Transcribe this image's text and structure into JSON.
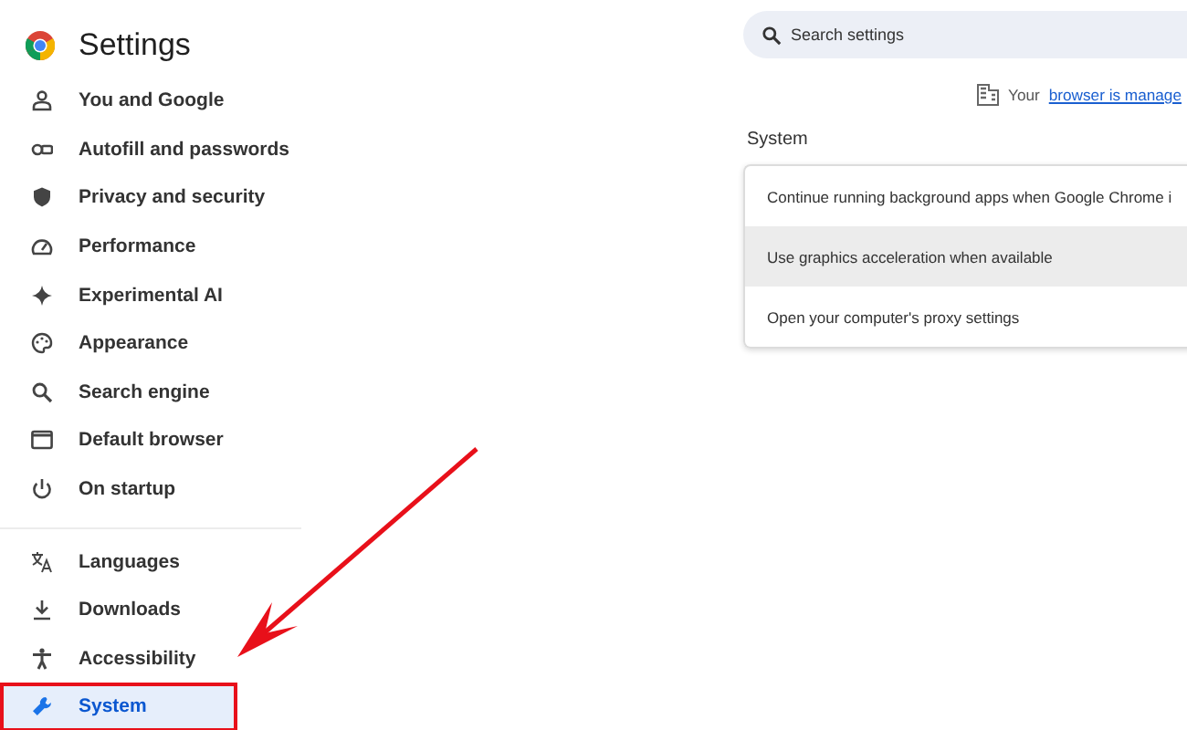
{
  "header": {
    "title": "Settings"
  },
  "sidebar": {
    "groups": [
      [
        {
          "label": "You and Google",
          "selected": false,
          "annotated": false
        },
        {
          "label": "Autofill and passwords",
          "selected": false,
          "annotated": false
        },
        {
          "label": "Privacy and security",
          "selected": false,
          "annotated": false
        },
        {
          "label": "Performance",
          "selected": false,
          "annotated": false
        },
        {
          "label": "Experimental AI",
          "selected": false,
          "annotated": false
        },
        {
          "label": "Appearance",
          "selected": false,
          "annotated": false
        },
        {
          "label": "Search engine",
          "selected": false,
          "annotated": false
        },
        {
          "label": "Default browser",
          "selected": false,
          "annotated": false
        },
        {
          "label": "On startup",
          "selected": false,
          "annotated": false
        }
      ],
      [
        {
          "label": "Languages",
          "selected": false,
          "annotated": false
        },
        {
          "label": "Downloads",
          "selected": false,
          "annotated": false
        },
        {
          "label": "Accessibility",
          "selected": false,
          "annotated": false
        },
        {
          "label": "System",
          "selected": true,
          "annotated": true
        }
      ]
    ]
  },
  "search": {
    "placeholder": "Search settings"
  },
  "managed_notice": {
    "text": "Your",
    "link": "browser is manage"
  },
  "section": {
    "title": "System",
    "rows": [
      {
        "label": "Continue running background apps when Google Chrome i",
        "highlighted": false
      },
      {
        "label": "Use graphics acceleration when available",
        "highlighted": true
      },
      {
        "label": "Open your computer's proxy settings",
        "highlighted": false
      }
    ]
  }
}
